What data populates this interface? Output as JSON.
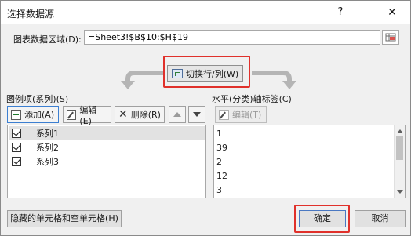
{
  "window": {
    "title": "选择数据源",
    "help_label": "?",
    "close_label": "✕"
  },
  "data_range": {
    "label": "图表数据区域(D):",
    "value": "=Sheet3!$B$10:$H$19"
  },
  "switch_button": {
    "label": "切换行/列(W)"
  },
  "legend_entries": {
    "label": "图例项(系列)(S)",
    "add_label": "添加(A)",
    "edit_label": "编辑(E)",
    "delete_label": "删除(R)",
    "series": [
      {
        "name": "系列1",
        "checked": true,
        "selected": true
      },
      {
        "name": "系列2",
        "checked": true,
        "selected": false
      },
      {
        "name": "系列3",
        "checked": true,
        "selected": false
      }
    ]
  },
  "axis_labels": {
    "label": "水平(分类)轴标签(C)",
    "edit_label": "编辑(T)",
    "items": [
      "1",
      "39",
      "2",
      "12",
      "3"
    ]
  },
  "footer": {
    "hidden_cells_label": "隐藏的单元格和空单元格(H)",
    "ok_label": "确定",
    "cancel_label": "取消"
  },
  "colors": {
    "highlight_border": "#e0312b",
    "focus_border": "#3c7fd1"
  }
}
